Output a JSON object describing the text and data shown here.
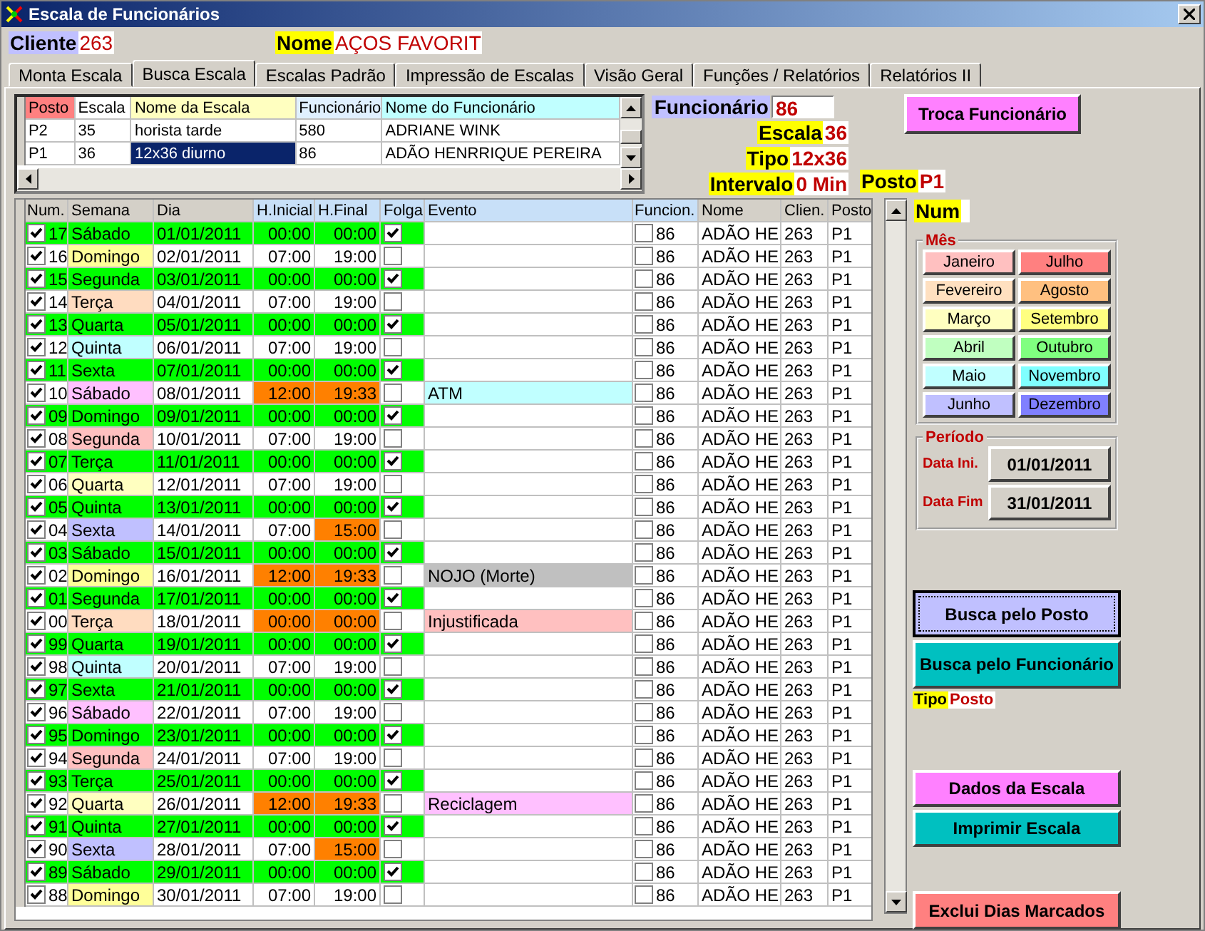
{
  "window": {
    "title": "Escala de Funcionários"
  },
  "client": {
    "label": "Cliente",
    "value": "263",
    "name_label": "Nome",
    "name_value": "AÇOS FAVORIT"
  },
  "tabs": [
    {
      "label": "Monta Escala",
      "selected": false
    },
    {
      "label": "Busca Escala",
      "selected": true
    },
    {
      "label": "Escalas Padrão",
      "selected": false
    },
    {
      "label": "Impressão de Escalas",
      "selected": false
    },
    {
      "label": "Visão Geral",
      "selected": false
    },
    {
      "label": "Funções / Relatórios",
      "selected": false
    },
    {
      "label": "Relatórios II",
      "selected": false
    }
  ],
  "schedule_list": {
    "columns": [
      {
        "label": "Posto",
        "color": "#ff8080"
      },
      {
        "label": "Escala",
        "color": "#ffffff"
      },
      {
        "label": "Nome da  Escala",
        "color": "#ffffc0"
      },
      {
        "label": "Funcionário",
        "color": "#e0f0ff"
      },
      {
        "label": "Nome do Funcionário",
        "color": "#c0ffff"
      }
    ],
    "rows": [
      {
        "cells": [
          "P2",
          "35",
          "horista tarde",
          "580",
          "ADRIANE WINK"
        ],
        "selected": false
      },
      {
        "cells": [
          "P1",
          "36",
          "12x36 diurno",
          "86",
          "ADÃO HENRRIQUE PEREIRA"
        ],
        "selected": true
      }
    ]
  },
  "info": [
    {
      "label": "Funcionário",
      "value": "86",
      "kind": "input"
    },
    {
      "label": "Escala",
      "value": "36",
      "kind": "text"
    },
    {
      "label": "Tipo",
      "value": "12x36",
      "kind": "text"
    },
    {
      "label": "Intervalo",
      "value": "0 Min",
      "kind": "text"
    }
  ],
  "swap_button": "Troca Funcionário",
  "post": {
    "label": "Posto",
    "value": "P1"
  },
  "num": {
    "label": "Num"
  },
  "grid": {
    "columns": [
      {
        "label": "Num.",
        "color": "#d4d0c8"
      },
      {
        "label": "Semana",
        "color": "#d4d0c8"
      },
      {
        "label": "Dia",
        "color": "#d4d0c8"
      },
      {
        "label": "H.Inicial",
        "color": "#c8e0f8"
      },
      {
        "label": "H.Final",
        "color": "#c8e0f8"
      },
      {
        "label": "Folga",
        "color": "#c8e0f8"
      },
      {
        "label": "Evento",
        "color": "#c8e0f8"
      },
      {
        "label": "Funcion.",
        "color": "#c8e0f8"
      },
      {
        "label": "Nome",
        "color": "#d4d0c8"
      },
      {
        "label": "Clien.",
        "color": "#d4d0c8"
      },
      {
        "label": "Posto",
        "color": "#d4d0c8"
      }
    ],
    "rows": [
      {
        "n": "17",
        "checked": true,
        "weekday": "Sábado",
        "date": "01/01/2011",
        "start": "00:00",
        "end": "00:00",
        "start_alert": false,
        "end_alert": false,
        "folga": true,
        "emp": "86",
        "emp_checked": false,
        "name": "ADÃO HE",
        "client": "263",
        "post": "P1"
      },
      {
        "n": "16",
        "checked": true,
        "weekday": "Domingo",
        "color": "#ffff99",
        "date": "02/01/2011",
        "start": "07:00",
        "end": "19:00",
        "start_alert": false,
        "end_alert": false,
        "folga": false,
        "emp": "86",
        "emp_checked": false,
        "name": "ADÃO HE",
        "client": "263",
        "post": "P1"
      },
      {
        "n": "15",
        "checked": true,
        "weekday": "Segunda",
        "date": "03/01/2011",
        "start": "00:00",
        "end": "00:00",
        "start_alert": false,
        "end_alert": false,
        "folga": true,
        "emp": "86",
        "emp_checked": false,
        "name": "ADÃO HE",
        "client": "263",
        "post": "P1"
      },
      {
        "n": "14",
        "checked": true,
        "weekday": "Terça",
        "color": "#ffdcc0",
        "date": "04/01/2011",
        "start": "07:00",
        "end": "19:00",
        "start_alert": false,
        "end_alert": false,
        "folga": false,
        "emp": "86",
        "emp_checked": false,
        "name": "ADÃO HE",
        "client": "263",
        "post": "P1"
      },
      {
        "n": "13",
        "checked": true,
        "weekday": "Quarta",
        "date": "05/01/2011",
        "start": "00:00",
        "end": "00:00",
        "start_alert": false,
        "end_alert": false,
        "folga": true,
        "emp": "86",
        "emp_checked": false,
        "name": "ADÃO HE",
        "client": "263",
        "post": "P1"
      },
      {
        "n": "12",
        "checked": true,
        "weekday": "Quinta",
        "color": "#c0ffff",
        "date": "06/01/2011",
        "start": "07:00",
        "end": "19:00",
        "start_alert": false,
        "end_alert": false,
        "folga": false,
        "emp": "86",
        "emp_checked": false,
        "name": "ADÃO HE",
        "client": "263",
        "post": "P1"
      },
      {
        "n": "11",
        "checked": true,
        "weekday": "Sexta",
        "date": "07/01/2011",
        "start": "00:00",
        "end": "00:00",
        "start_alert": false,
        "end_alert": false,
        "folga": true,
        "emp": "86",
        "emp_checked": false,
        "name": "ADÃO HE",
        "client": "263",
        "post": "P1"
      },
      {
        "n": "10",
        "checked": true,
        "weekday": "Sábado",
        "color": "#ffc0ff",
        "date": "08/01/2011",
        "start": "12:00",
        "end": "19:33",
        "start_alert": true,
        "end_alert": true,
        "folga": false,
        "event": {
          "label": "ATM",
          "color": "#c0ffff"
        },
        "emp": "86",
        "emp_checked": false,
        "name": "ADÃO HE",
        "client": "263",
        "post": "P1"
      },
      {
        "n": "09",
        "checked": true,
        "weekday": "Domingo",
        "date": "09/01/2011",
        "start": "00:00",
        "end": "00:00",
        "start_alert": false,
        "end_alert": false,
        "folga": true,
        "emp": "86",
        "emp_checked": false,
        "name": "ADÃO HE",
        "client": "263",
        "post": "P1"
      },
      {
        "n": "08",
        "checked": true,
        "weekday": "Segunda",
        "color": "#ffc0c0",
        "date": "10/01/2011",
        "start": "07:00",
        "end": "19:00",
        "start_alert": false,
        "end_alert": false,
        "folga": false,
        "emp": "86",
        "emp_checked": false,
        "name": "ADÃO HE",
        "client": "263",
        "post": "P1"
      },
      {
        "n": "07",
        "checked": true,
        "weekday": "Terça",
        "date": "11/01/2011",
        "start": "00:00",
        "end": "00:00",
        "start_alert": false,
        "end_alert": false,
        "folga": true,
        "emp": "86",
        "emp_checked": false,
        "name": "ADÃO HE",
        "client": "263",
        "post": "P1"
      },
      {
        "n": "06",
        "checked": true,
        "weekday": "Quarta",
        "color": "#ffffc0",
        "date": "12/01/2011",
        "start": "07:00",
        "end": "19:00",
        "start_alert": false,
        "end_alert": false,
        "folga": false,
        "emp": "86",
        "emp_checked": false,
        "name": "ADÃO HE",
        "client": "263",
        "post": "P1"
      },
      {
        "n": "05",
        "checked": true,
        "weekday": "Quinta",
        "date": "13/01/2011",
        "start": "00:00",
        "end": "00:00",
        "start_alert": false,
        "end_alert": false,
        "folga": true,
        "emp": "86",
        "emp_checked": false,
        "name": "ADÃO HE",
        "client": "263",
        "post": "P1"
      },
      {
        "n": "04",
        "checked": true,
        "weekday": "Sexta",
        "color": "#c0c0ff",
        "date": "14/01/2011",
        "start": "07:00",
        "end": "15:00",
        "start_alert": false,
        "end_alert": true,
        "folga": false,
        "emp": "86",
        "emp_checked": false,
        "name": "ADÃO HE",
        "client": "263",
        "post": "P1"
      },
      {
        "n": "03",
        "checked": true,
        "weekday": "Sábado",
        "date": "15/01/2011",
        "start": "00:00",
        "end": "00:00",
        "start_alert": false,
        "end_alert": false,
        "folga": true,
        "emp": "86",
        "emp_checked": false,
        "name": "ADÃO HE",
        "client": "263",
        "post": "P1"
      },
      {
        "n": "02",
        "checked": true,
        "weekday": "Domingo",
        "color": "#ffff99",
        "date": "16/01/2011",
        "start": "12:00",
        "end": "19:33",
        "start_alert": true,
        "end_alert": true,
        "folga": false,
        "event": {
          "label": "NOJO (Morte)",
          "color": "#c0c0c0"
        },
        "emp": "86",
        "emp_checked": false,
        "name": "ADÃO HE",
        "client": "263",
        "post": "P1"
      },
      {
        "n": "01",
        "checked": true,
        "weekday": "Segunda",
        "date": "17/01/2011",
        "start": "00:00",
        "end": "00:00",
        "start_alert": false,
        "end_alert": false,
        "folga": true,
        "emp": "86",
        "emp_checked": false,
        "name": "ADÃO HE",
        "client": "263",
        "post": "P1"
      },
      {
        "n": "00",
        "checked": true,
        "weekday": "Terça",
        "color": "#ffdcc0",
        "date": "18/01/2011",
        "start": "00:00",
        "end": "00:00",
        "start_alert": true,
        "end_alert": true,
        "folga": false,
        "event": {
          "label": "Injustificada",
          "color": "#ffc0c0"
        },
        "emp": "86",
        "emp_checked": false,
        "name": "ADÃO HE",
        "client": "263",
        "post": "P1"
      },
      {
        "n": "99",
        "checked": true,
        "weekday": "Quarta",
        "date": "19/01/2011",
        "start": "00:00",
        "end": "00:00",
        "start_alert": false,
        "end_alert": false,
        "folga": true,
        "emp": "86",
        "emp_checked": false,
        "name": "ADÃO HE",
        "client": "263",
        "post": "P1"
      },
      {
        "n": "98",
        "checked": true,
        "weekday": "Quinta",
        "color": "#c0ffff",
        "date": "20/01/2011",
        "start": "07:00",
        "end": "19:00",
        "start_alert": false,
        "end_alert": false,
        "folga": false,
        "emp": "86",
        "emp_checked": false,
        "name": "ADÃO HE",
        "client": "263",
        "post": "P1"
      },
      {
        "n": "97",
        "checked": true,
        "weekday": "Sexta",
        "date": "21/01/2011",
        "start": "00:00",
        "end": "00:00",
        "start_alert": false,
        "end_alert": false,
        "folga": true,
        "emp": "86",
        "emp_checked": false,
        "name": "ADÃO HE",
        "client": "263",
        "post": "P1"
      },
      {
        "n": "96",
        "checked": true,
        "weekday": "Sábado",
        "color": "#ffc0ff",
        "date": "22/01/2011",
        "start": "07:00",
        "end": "19:00",
        "start_alert": false,
        "end_alert": false,
        "folga": false,
        "emp": "86",
        "emp_checked": false,
        "name": "ADÃO HE",
        "client": "263",
        "post": "P1"
      },
      {
        "n": "95",
        "checked": true,
        "weekday": "Domingo",
        "date": "23/01/2011",
        "start": "00:00",
        "end": "00:00",
        "start_alert": false,
        "end_alert": false,
        "folga": true,
        "emp": "86",
        "emp_checked": false,
        "name": "ADÃO HE",
        "client": "263",
        "post": "P1"
      },
      {
        "n": "94",
        "checked": true,
        "weekday": "Segunda",
        "color": "#ffc0c0",
        "date": "24/01/2011",
        "start": "07:00",
        "end": "19:00",
        "start_alert": false,
        "end_alert": false,
        "folga": false,
        "emp": "86",
        "emp_checked": false,
        "name": "ADÃO HE",
        "client": "263",
        "post": "P1"
      },
      {
        "n": "93",
        "checked": true,
        "weekday": "Terça",
        "date": "25/01/2011",
        "start": "00:00",
        "end": "00:00",
        "start_alert": false,
        "end_alert": false,
        "folga": true,
        "emp": "86",
        "emp_checked": false,
        "name": "ADÃO HE",
        "client": "263",
        "post": "P1"
      },
      {
        "n": "92",
        "checked": true,
        "weekday": "Quarta",
        "color": "#ffffc0",
        "date": "26/01/2011",
        "start": "12:00",
        "end": "19:33",
        "start_alert": true,
        "end_alert": true,
        "folga": false,
        "event": {
          "label": "Reciclagem",
          "color": "#ffc0ff"
        },
        "emp": "86",
        "emp_checked": false,
        "name": "ADÃO HE",
        "client": "263",
        "post": "P1"
      },
      {
        "n": "91",
        "checked": true,
        "weekday": "Quinta",
        "date": "27/01/2011",
        "start": "00:00",
        "end": "00:00",
        "start_alert": false,
        "end_alert": false,
        "folga": true,
        "emp": "86",
        "emp_checked": false,
        "name": "ADÃO HE",
        "client": "263",
        "post": "P1"
      },
      {
        "n": "90",
        "checked": true,
        "weekday": "Sexta",
        "color": "#c0c0ff",
        "date": "28/01/2011",
        "start": "07:00",
        "end": "15:00",
        "start_alert": false,
        "end_alert": true,
        "folga": false,
        "emp": "86",
        "emp_checked": false,
        "name": "ADÃO HE",
        "client": "263",
        "post": "P1"
      },
      {
        "n": "89",
        "checked": true,
        "weekday": "Sábado",
        "date": "29/01/2011",
        "start": "00:00",
        "end": "00:00",
        "start_alert": false,
        "end_alert": false,
        "folga": true,
        "emp": "86",
        "emp_checked": false,
        "name": "ADÃO HE",
        "client": "263",
        "post": "P1"
      },
      {
        "n": "88",
        "checked": true,
        "weekday": "Domingo",
        "color": "#ffff99",
        "date": "30/01/2011",
        "start": "07:00",
        "end": "19:00",
        "start_alert": false,
        "end_alert": false,
        "folga": false,
        "emp": "86",
        "emp_checked": false,
        "name": "ADÃO HE",
        "client": "263",
        "post": "P1"
      }
    ]
  },
  "month_group": {
    "title": "Mês",
    "months": [
      {
        "label": "Janeiro",
        "color": "#ffc0c0"
      },
      {
        "label": "Julho",
        "color": "#ff8080"
      },
      {
        "label": "Fevereiro",
        "color": "#ffe0c0"
      },
      {
        "label": "Agosto",
        "color": "#ffc080"
      },
      {
        "label": "Março",
        "color": "#ffffc0"
      },
      {
        "label": "Setembro",
        "color": "#ffff80"
      },
      {
        "label": "Abril",
        "color": "#c0ffc0"
      },
      {
        "label": "Outubro",
        "color": "#80ff80"
      },
      {
        "label": "Maio",
        "color": "#c0ffff"
      },
      {
        "label": "Novembro",
        "color": "#80ffff"
      },
      {
        "label": "Junho",
        "color": "#c0c0ff"
      },
      {
        "label": "Dezembro",
        "color": "#8080ff"
      }
    ]
  },
  "period": {
    "title": "Período",
    "start_label": "Data Ini.",
    "start": "01/01/2011",
    "end_label": "Data Fim",
    "end": "31/01/2011"
  },
  "search_buttons": [
    "Busca pelo Posto",
    "Busca pelo Funcionário"
  ],
  "search_type": {
    "label": "Tipo",
    "value": "Posto"
  },
  "action_buttons": [
    "Dados da Escala",
    "Imprimir Escala"
  ],
  "delete_button": "Exclui Dias Marcados"
}
